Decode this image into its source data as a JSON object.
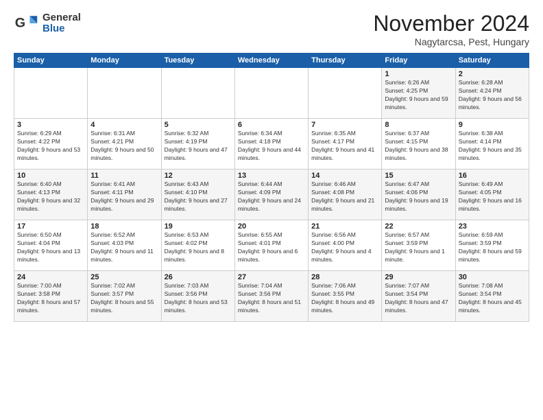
{
  "logo": {
    "general": "General",
    "blue": "Blue"
  },
  "title": "November 2024",
  "subtitle": "Nagytarcsa, Pest, Hungary",
  "days_header": [
    "Sunday",
    "Monday",
    "Tuesday",
    "Wednesday",
    "Thursday",
    "Friday",
    "Saturday"
  ],
  "weeks": [
    [
      {
        "day": "",
        "info": ""
      },
      {
        "day": "",
        "info": ""
      },
      {
        "day": "",
        "info": ""
      },
      {
        "day": "",
        "info": ""
      },
      {
        "day": "",
        "info": ""
      },
      {
        "day": "1",
        "info": "Sunrise: 6:26 AM\nSunset: 4:25 PM\nDaylight: 9 hours and 59 minutes."
      },
      {
        "day": "2",
        "info": "Sunrise: 6:28 AM\nSunset: 4:24 PM\nDaylight: 9 hours and 56 minutes."
      }
    ],
    [
      {
        "day": "3",
        "info": "Sunrise: 6:29 AM\nSunset: 4:22 PM\nDaylight: 9 hours and 53 minutes."
      },
      {
        "day": "4",
        "info": "Sunrise: 6:31 AM\nSunset: 4:21 PM\nDaylight: 9 hours and 50 minutes."
      },
      {
        "day": "5",
        "info": "Sunrise: 6:32 AM\nSunset: 4:19 PM\nDaylight: 9 hours and 47 minutes."
      },
      {
        "day": "6",
        "info": "Sunrise: 6:34 AM\nSunset: 4:18 PM\nDaylight: 9 hours and 44 minutes."
      },
      {
        "day": "7",
        "info": "Sunrise: 6:35 AM\nSunset: 4:17 PM\nDaylight: 9 hours and 41 minutes."
      },
      {
        "day": "8",
        "info": "Sunrise: 6:37 AM\nSunset: 4:15 PM\nDaylight: 9 hours and 38 minutes."
      },
      {
        "day": "9",
        "info": "Sunrise: 6:38 AM\nSunset: 4:14 PM\nDaylight: 9 hours and 35 minutes."
      }
    ],
    [
      {
        "day": "10",
        "info": "Sunrise: 6:40 AM\nSunset: 4:13 PM\nDaylight: 9 hours and 32 minutes."
      },
      {
        "day": "11",
        "info": "Sunrise: 6:41 AM\nSunset: 4:11 PM\nDaylight: 9 hours and 29 minutes."
      },
      {
        "day": "12",
        "info": "Sunrise: 6:43 AM\nSunset: 4:10 PM\nDaylight: 9 hours and 27 minutes."
      },
      {
        "day": "13",
        "info": "Sunrise: 6:44 AM\nSunset: 4:09 PM\nDaylight: 9 hours and 24 minutes."
      },
      {
        "day": "14",
        "info": "Sunrise: 6:46 AM\nSunset: 4:08 PM\nDaylight: 9 hours and 21 minutes."
      },
      {
        "day": "15",
        "info": "Sunrise: 6:47 AM\nSunset: 4:06 PM\nDaylight: 9 hours and 19 minutes."
      },
      {
        "day": "16",
        "info": "Sunrise: 6:49 AM\nSunset: 4:05 PM\nDaylight: 9 hours and 16 minutes."
      }
    ],
    [
      {
        "day": "17",
        "info": "Sunrise: 6:50 AM\nSunset: 4:04 PM\nDaylight: 9 hours and 13 minutes."
      },
      {
        "day": "18",
        "info": "Sunrise: 6:52 AM\nSunset: 4:03 PM\nDaylight: 9 hours and 11 minutes."
      },
      {
        "day": "19",
        "info": "Sunrise: 6:53 AM\nSunset: 4:02 PM\nDaylight: 9 hours and 8 minutes."
      },
      {
        "day": "20",
        "info": "Sunrise: 6:55 AM\nSunset: 4:01 PM\nDaylight: 9 hours and 6 minutes."
      },
      {
        "day": "21",
        "info": "Sunrise: 6:56 AM\nSunset: 4:00 PM\nDaylight: 9 hours and 4 minutes."
      },
      {
        "day": "22",
        "info": "Sunrise: 6:57 AM\nSunset: 3:59 PM\nDaylight: 9 hours and 1 minute."
      },
      {
        "day": "23",
        "info": "Sunrise: 6:59 AM\nSunset: 3:59 PM\nDaylight: 8 hours and 59 minutes."
      }
    ],
    [
      {
        "day": "24",
        "info": "Sunrise: 7:00 AM\nSunset: 3:58 PM\nDaylight: 8 hours and 57 minutes."
      },
      {
        "day": "25",
        "info": "Sunrise: 7:02 AM\nSunset: 3:57 PM\nDaylight: 8 hours and 55 minutes."
      },
      {
        "day": "26",
        "info": "Sunrise: 7:03 AM\nSunset: 3:56 PM\nDaylight: 8 hours and 53 minutes."
      },
      {
        "day": "27",
        "info": "Sunrise: 7:04 AM\nSunset: 3:56 PM\nDaylight: 8 hours and 51 minutes."
      },
      {
        "day": "28",
        "info": "Sunrise: 7:06 AM\nSunset: 3:55 PM\nDaylight: 8 hours and 49 minutes."
      },
      {
        "day": "29",
        "info": "Sunrise: 7:07 AM\nSunset: 3:54 PM\nDaylight: 8 hours and 47 minutes."
      },
      {
        "day": "30",
        "info": "Sunrise: 7:08 AM\nSunset: 3:54 PM\nDaylight: 8 hours and 45 minutes."
      }
    ]
  ]
}
